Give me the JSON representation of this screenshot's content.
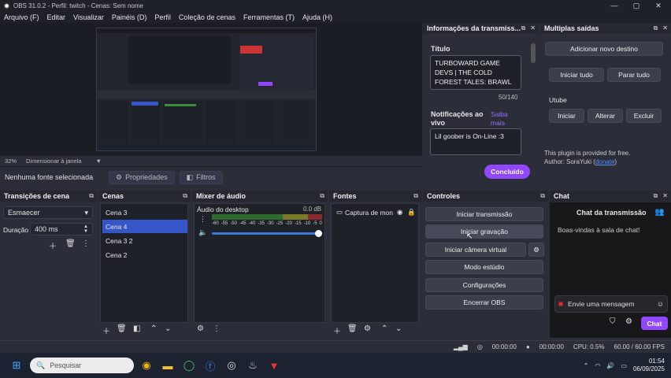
{
  "window": {
    "title": "OBS 31.0.2 - Perfil: twitch - Cenas: Sem nome"
  },
  "menu": [
    "Arquivo (F)",
    "Editar",
    "Visualizar",
    "Painéis (D)",
    "Perfil",
    "Coleção de cenas",
    "Ferramentas (T)",
    "Ajuda (H)"
  ],
  "preview": {
    "zoom": "32%",
    "mode": "Dimensionar à janela"
  },
  "source_bar": {
    "none_selected": "Nenhuma fonte selecionada",
    "properties": "Propriedades",
    "filters": "Filtros"
  },
  "stream_info": {
    "header": "Informações da transmiss...",
    "title_label": "Título",
    "title_value": "TURBOWARD GAME DEVS | THE COLD FOREST TALES: BRAWL",
    "char_count": "50/140",
    "notif_label": "Notificações ao vivo",
    "learn_more": "Saiba mais",
    "notif_value": "Lil goober is On-Line :3",
    "done_button": "Concluído"
  },
  "multi_output": {
    "header": "Multiplas saídas",
    "add_dest": "Adicionar novo destino",
    "start_all": "Iniciar tudo",
    "stop_all": "Parar tudo",
    "dest_name": "Utube",
    "start": "Iniciar",
    "edit": "Alterar",
    "delete": "Excluir",
    "plugin_note": "This plugin is provided for free.",
    "author_prefix": "Author: SoraYuki (",
    "author_link": "donate",
    "author_suffix": ")"
  },
  "transitions": {
    "header": "Transições de cena",
    "selected": "Esmaecer",
    "duration_label": "Duração",
    "duration_value": "400 ms"
  },
  "scenes": {
    "header": "Cenas",
    "items": [
      "Cena 3",
      "Cena 4",
      "Cena 3 2",
      "Cena 2"
    ],
    "selected_index": 1
  },
  "mixer": {
    "header": "Mixer de áudio",
    "track": "Áudio do desktop",
    "db": "0.0 dB",
    "scale": [
      "-60",
      "-55",
      "-50",
      "-45",
      "-40",
      "-35",
      "-30",
      "-25",
      "-20",
      "-15",
      "-10",
      "-5",
      "0"
    ],
    "volume": 0.97
  },
  "sources": {
    "header": "Fontes",
    "items": [
      "Captura de mon"
    ]
  },
  "controls": {
    "header": "Controles",
    "buttons": [
      "Iniciar transmissão",
      "Iniciar gravação",
      "Iniciar câmera virtual",
      "Modo estúdio",
      "Configurações",
      "Encerrar OBS"
    ]
  },
  "chat": {
    "header": "Chat",
    "title": "Chat da transmissão",
    "welcome": "Boas-vindas à sala de chat!",
    "placeholder": "Envie uma mensagem",
    "send": "Chat"
  },
  "status": {
    "rec_time": "00:00:00",
    "stream_time": "00:00:00",
    "cpu": "CPU: 0.5%",
    "fps": "60.00 / 60.00 FPS"
  },
  "taskbar": {
    "search": "Pesquisar",
    "time": "01:54",
    "date": "06/09/2025"
  },
  "colors": {
    "accent": "#9147ff",
    "selection": "#3556c8",
    "bg": "#2b2e38"
  }
}
